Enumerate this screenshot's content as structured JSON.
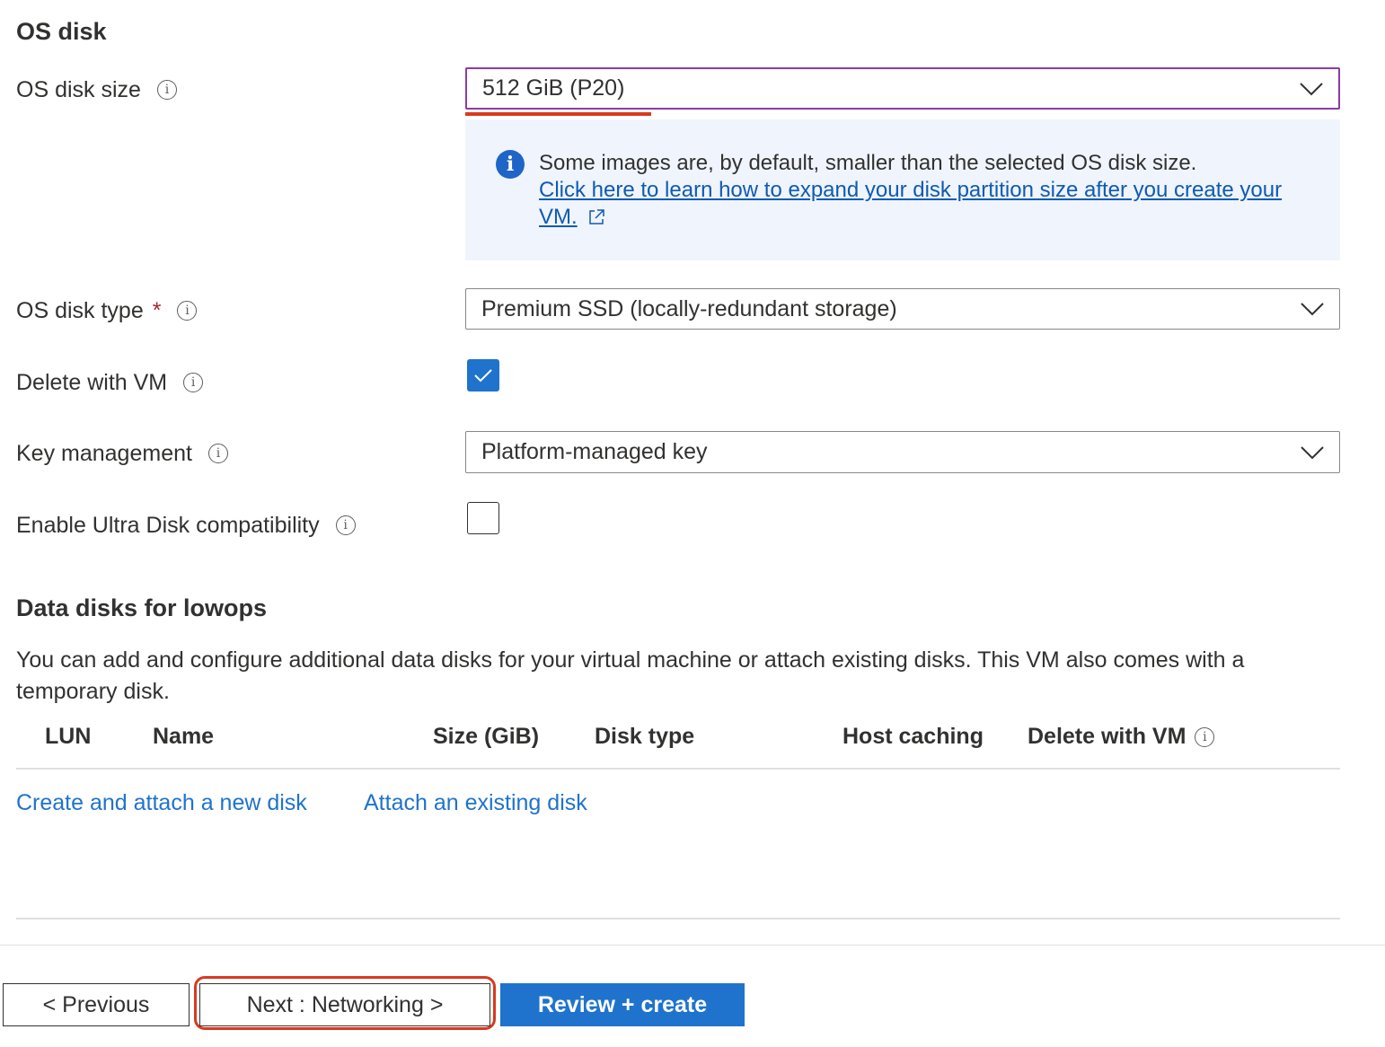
{
  "os_disk": {
    "heading": "OS disk",
    "size": {
      "label": "OS disk size",
      "value": "512 GiB (P20)"
    },
    "info": {
      "text": "Some images are, by default, smaller than the selected OS disk size.",
      "link_line1": "Click here to learn how to expand your disk partition size after you create your",
      "link_line2": "VM."
    },
    "type": {
      "label": "OS disk type",
      "required": "*",
      "value": "Premium SSD (locally-redundant storage)"
    },
    "delete_with_vm": {
      "label": "Delete with VM",
      "checked": true
    },
    "key_management": {
      "label": "Key management",
      "value": "Platform-managed key"
    },
    "ultra_disk": {
      "label": "Enable Ultra Disk compatibility",
      "checked": false
    }
  },
  "data_disks": {
    "heading": "Data disks for lowops",
    "description": "You can add and configure additional data disks for your virtual machine or attach existing disks. This VM also comes with a temporary disk.",
    "columns": [
      "LUN",
      "Name",
      "Size (GiB)",
      "Disk type",
      "Host caching",
      "Delete with VM"
    ],
    "create_link": "Create and attach a new disk",
    "attach_link": "Attach an existing disk"
  },
  "footer": {
    "previous_label": "< Previous",
    "next_label": "Next : Networking >",
    "review_label": "Review + create"
  },
  "colors": {
    "accent_blue": "#1f73cc",
    "focus_purple": "#8a3ca8",
    "annotation_red": "#d9391f",
    "info_bg": "#eff4fd"
  }
}
